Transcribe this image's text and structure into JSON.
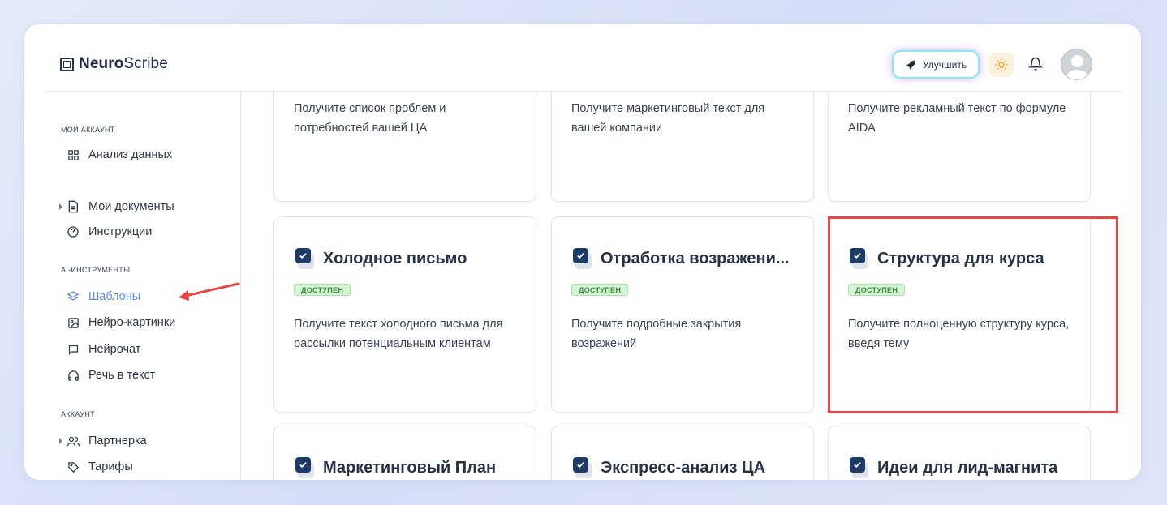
{
  "brand": {
    "name_bold": "Neuro",
    "name_rest": "Scribe"
  },
  "header": {
    "upgrade_label": "Улучшить"
  },
  "sidebar": {
    "sections": {
      "my_account": "МОЙ АККАУНТ",
      "ai_tools": "AI-ИНСТРУМЕНТЫ",
      "account": "АККАУНТ"
    },
    "items": {
      "data_analysis": "Анализ данных",
      "my_documents": "Мои документы",
      "instructions": "Инструкции",
      "templates": "Шаблоны",
      "neuro_images": "Нейро-картинки",
      "neurochat": "Нейрочат",
      "speech_to_text": "Речь в текст",
      "partner": "Партнерка",
      "tariffs": "Тарифы"
    }
  },
  "badge_label": "ДОСТУПЕН",
  "cards": {
    "top": [
      {
        "desc": "Получите список проблем и потребностей вашей ЦА"
      },
      {
        "desc": "Получите маркетинговый текст для вашей компании"
      },
      {
        "desc": "Получите рекламный текст по формуле AIDA"
      }
    ],
    "middle": [
      {
        "title": "Холодное письмо",
        "desc": "Получите текст холодного письма для рассылки потенциальным клиентам"
      },
      {
        "title": "Отработка возражени...",
        "desc": "Получите подробные закрытия возражений"
      },
      {
        "title": "Структура для курса",
        "desc": "Получите полноценную структуру курса, введя тему"
      }
    ],
    "bottom": [
      {
        "title": "Маркетинговый План"
      },
      {
        "title": "Экспресс-анализ ЦА"
      },
      {
        "title": "Идеи для лид-магнита"
      }
    ]
  },
  "colors": {
    "accent": "#5b8fd9",
    "highlight": "#e84545",
    "badge_bg": "#d6f5d6",
    "icon_blue": "#1e3a66"
  }
}
